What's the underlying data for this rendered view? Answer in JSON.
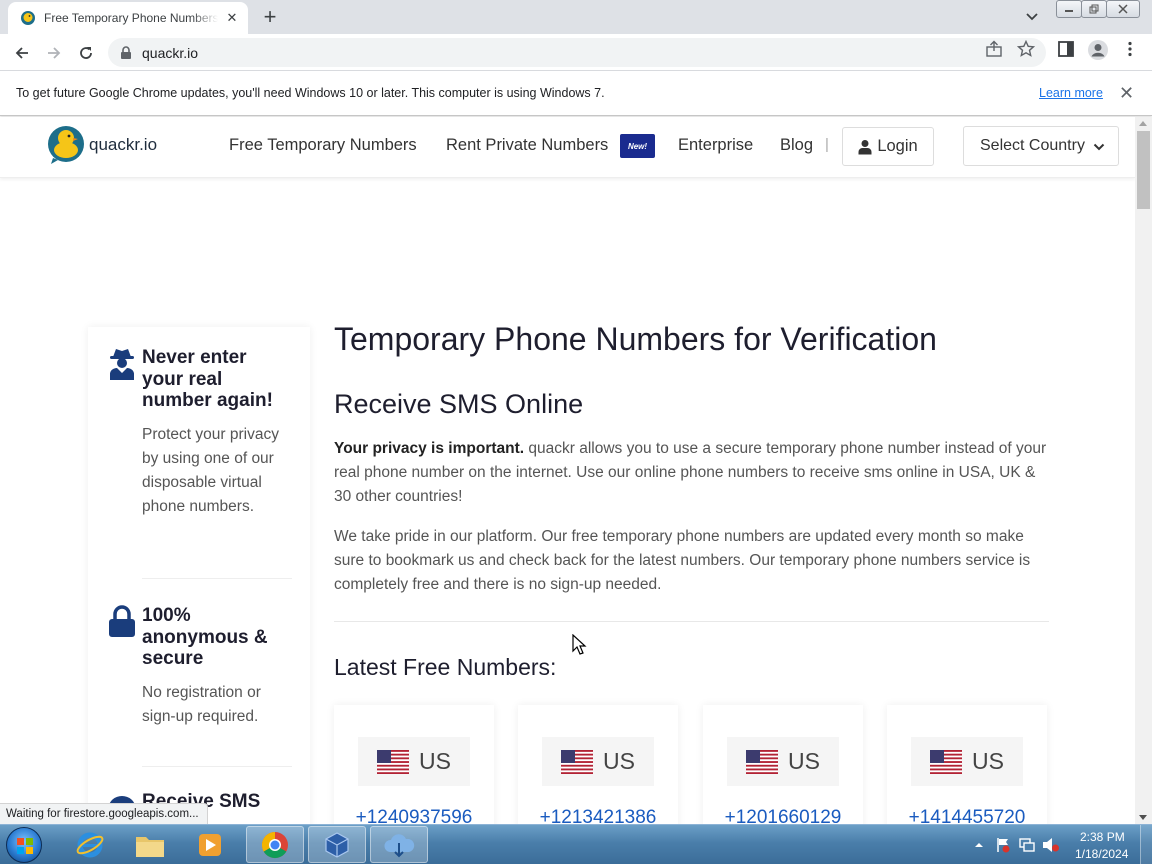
{
  "browser": {
    "tab_title": "Free Temporary Phone Numbers",
    "tab_close": "✕",
    "new_tab": "+",
    "url": "quackr.io",
    "window_controls": [
      "minimize",
      "restore",
      "close"
    ]
  },
  "infobar": {
    "message": "To get future Google Chrome updates, you'll need Windows 10 or later. This computer is using Windows 7.",
    "link": "Learn more",
    "close": "✕"
  },
  "site": {
    "logo_text": "quackr.io",
    "nav": {
      "free_numbers": "Free Temporary Numbers",
      "rent_numbers": "Rent Private Numbers",
      "new_badge": "New!",
      "enterprise": "Enterprise",
      "blog": "Blog",
      "separator": "|",
      "login": "Login",
      "select_country": "Select Country"
    }
  },
  "sidebar": {
    "features": [
      {
        "icon": "spy-icon",
        "title": "Never enter your real number again!",
        "desc": "Protect your privacy by using one of our disposable virtual phone numbers."
      },
      {
        "icon": "lock-icon",
        "title": "100% anonymous & secure",
        "desc": "No registration or sign-up required."
      },
      {
        "icon": "sms-icon",
        "title": "Receive SMS",
        "desc": ""
      }
    ]
  },
  "main": {
    "title": "Temporary Phone Numbers for Verification",
    "subtitle": "Receive SMS Online",
    "para1_bold": "Your privacy is important.",
    "para1_rest": " quackr allows you to use a secure temporary phone number instead of your real phone number on the internet. Use our online phone numbers to receive sms online in USA, UK & 30 other countries!",
    "para2": "We take pride in our platform. Our free temporary phone numbers are updated every month so make sure to bookmark us and check back for the latest numbers. Our temporary phone numbers service is completely free and there is no sign-up needed.",
    "latest_heading": "Latest Free Numbers:",
    "numbers": [
      {
        "country": "US",
        "number": "+1240937596"
      },
      {
        "country": "US",
        "number": "+1213421386"
      },
      {
        "country": "US",
        "number": "+1201660129"
      },
      {
        "country": "US",
        "number": "+1414455720"
      }
    ]
  },
  "status_bar": "Waiting for firestore.googleapis.com...",
  "taskbar": {
    "time": "2:38 PM",
    "date": "1/18/2024",
    "pinned": [
      "internet-explorer-icon",
      "file-explorer-icon",
      "media-player-icon",
      "chrome-icon",
      "virtualbox-icon",
      "cloud-download-icon"
    ]
  },
  "colors": {
    "brand_blue": "#1a2b8f",
    "link_blue": "#1a5bbf",
    "heading": "#1e1e2e",
    "duck_yellow": "#f5c518",
    "duck_teal": "#1d6e8a"
  }
}
